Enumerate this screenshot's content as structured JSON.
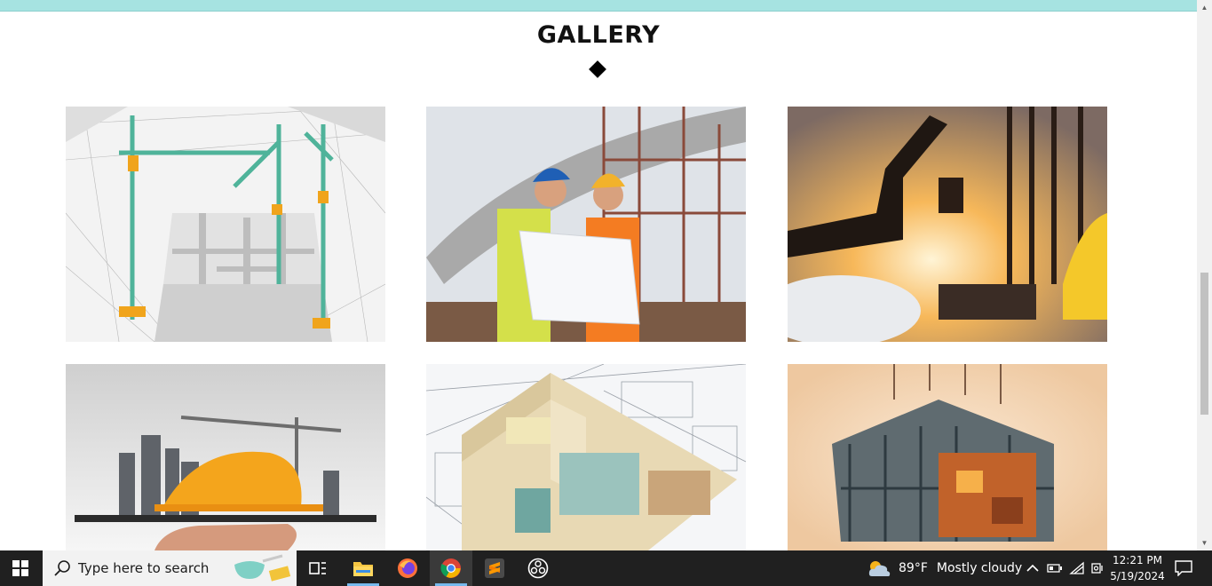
{
  "page": {
    "heading": "GALLERY",
    "accent_color": "#a6e3e1"
  },
  "gallery": [
    {
      "name": "crane-blueprint-model",
      "alt": "Construction cranes over 3D floor plan model"
    },
    {
      "name": "engineers-reviewing-plans",
      "alt": "Two engineers in hard hats reviewing blueprint"
    },
    {
      "name": "excavator-sunset-blueprints",
      "alt": "Excavator at sunset with blueprints and helmet"
    },
    {
      "name": "hand-holding-city-tablet",
      "alt": "Hand holding tablet with city and hard hat"
    },
    {
      "name": "isometric-house-plan",
      "alt": "Isometric 3D house plan on blueprint"
    },
    {
      "name": "steel-frame-building-sketch",
      "alt": "Steel frame building illustration"
    }
  ],
  "taskbar": {
    "search_placeholder": "Type here to search",
    "apps": [
      {
        "name": "task-view",
        "icon": "task-view-icon"
      },
      {
        "name": "file-explorer",
        "icon": "folder-icon"
      },
      {
        "name": "firefox",
        "icon": "firefox-icon"
      },
      {
        "name": "chrome",
        "icon": "chrome-icon"
      },
      {
        "name": "sublime-text",
        "icon": "sublime-icon"
      },
      {
        "name": "obs-studio",
        "icon": "obs-icon"
      }
    ],
    "weather": {
      "temp": "89°F",
      "desc": "Mostly cloudy"
    },
    "clock": {
      "time": "12:21 PM",
      "date": "5/19/2024"
    }
  }
}
